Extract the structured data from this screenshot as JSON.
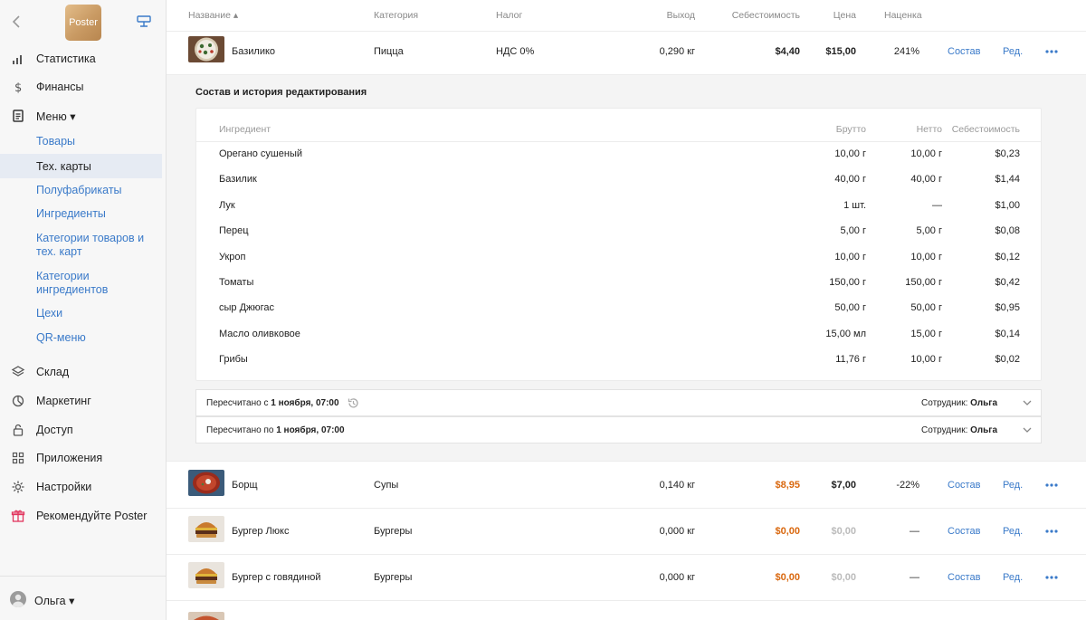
{
  "app": {
    "logo_text": "Poster"
  },
  "sidebar": {
    "items": [
      {
        "label": "Статистика",
        "icon": "chart-bars-icon"
      },
      {
        "label": "Финансы",
        "icon": "dollar-icon"
      },
      {
        "label": "Меню ▾",
        "icon": "document-icon"
      },
      {
        "label": "Склад",
        "icon": "layers-icon"
      },
      {
        "label": "Маркетинг",
        "icon": "pie-icon"
      },
      {
        "label": "Доступ",
        "icon": "lock-icon"
      },
      {
        "label": "Приложения",
        "icon": "grid-icon"
      },
      {
        "label": "Настройки",
        "icon": "gear-icon"
      },
      {
        "label": "Рекомендуйте Poster",
        "icon": "gift-icon"
      }
    ],
    "submenu": [
      {
        "label": "Товары"
      },
      {
        "label": "Тех. карты"
      },
      {
        "label": "Полуфабрикаты"
      },
      {
        "label": "Ингредиенты"
      },
      {
        "label": "Категории товаров и тех. карт"
      },
      {
        "label": "Категории ингредиентов"
      },
      {
        "label": "Цехи"
      },
      {
        "label": "QR-меню"
      }
    ],
    "user": "Ольга ▾"
  },
  "table": {
    "headers": {
      "name": "Название ▴",
      "category": "Категория",
      "tax": "Налог",
      "yield": "Выход",
      "cost": "Себестоимость",
      "price": "Цена",
      "markup": "Наценка"
    },
    "action_labels": {
      "composition": "Состав",
      "edit": "Ред."
    },
    "rows": [
      {
        "name": "Базилико",
        "category": "Пицца",
        "tax": "НДС 0%",
        "yield": "0,290 кг",
        "cost": "$4,40",
        "price": "$15,00",
        "markup": "241%"
      },
      {
        "name": "Борщ",
        "category": "Супы",
        "tax": "",
        "yield": "0,140 кг",
        "cost": "$8,95",
        "price": "$7,00",
        "markup": "-22%"
      },
      {
        "name": "Бургер Люкс",
        "category": "Бургеры",
        "tax": "",
        "yield": "0,000 кг",
        "cost": "$0,00",
        "price": "$0,00",
        "markup": "—"
      },
      {
        "name": "Бургер с говядиной",
        "category": "Бургеры",
        "tax": "",
        "yield": "0,000 кг",
        "cost": "$0,00",
        "price": "$0,00",
        "markup": "—"
      }
    ]
  },
  "composition": {
    "title": "Состав и история редактирования",
    "headers": {
      "ingredient": "Ингредиент",
      "gross": "Брутто",
      "net": "Нетто",
      "cost": "Себестоимость"
    },
    "ingredients": [
      {
        "name": "Орегано сушеный",
        "gross": "10,00 г",
        "net": "10,00 г",
        "cost": "$0,23"
      },
      {
        "name": "Базилик",
        "gross": "40,00 г",
        "net": "40,00 г",
        "cost": "$1,44"
      },
      {
        "name": "Лук",
        "gross": "1 шт.",
        "net": "—",
        "cost": "$1,00"
      },
      {
        "name": "Перец",
        "gross": "5,00 г",
        "net": "5,00 г",
        "cost": "$0,08"
      },
      {
        "name": "Укроп",
        "gross": "10,00 г",
        "net": "10,00 г",
        "cost": "$0,12"
      },
      {
        "name": "Томаты",
        "gross": "150,00 г",
        "net": "150,00 г",
        "cost": "$0,42"
      },
      {
        "name": "сыр Джюгас",
        "gross": "50,00 г",
        "net": "50,00 г",
        "cost": "$0,95"
      },
      {
        "name": "Масло оливковое",
        "gross": "15,00 мл",
        "net": "15,00 г",
        "cost": "$0,14"
      },
      {
        "name": "Грибы",
        "gross": "11,76 г",
        "net": "10,00 г",
        "cost": "$0,02"
      }
    ],
    "history": [
      {
        "prefix": "Пересчитано с ",
        "date": "1 ноября, 07:00",
        "employee_label": "Сотрудник: ",
        "employee": "Ольга"
      },
      {
        "prefix": "Пересчитано по ",
        "date": "1 ноября, 07:00",
        "employee_label": "Сотрудник: ",
        "employee": "Ольга"
      }
    ]
  }
}
